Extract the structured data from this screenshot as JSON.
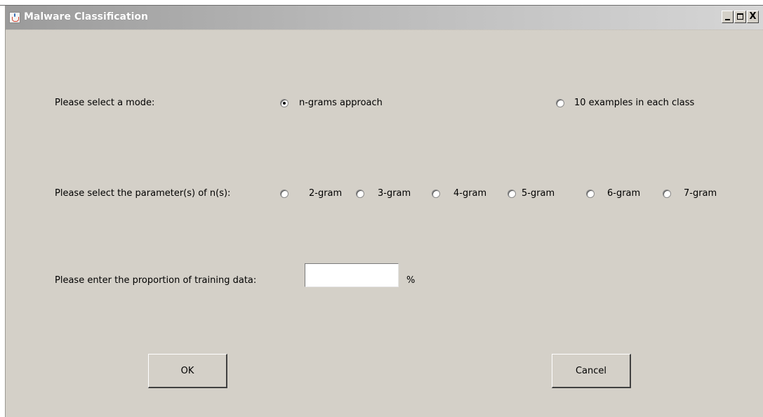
{
  "window": {
    "title": "Malware Classification",
    "icon": "java-cup-icon",
    "controls": {
      "minimize": "minimize-icon",
      "maximize": "maximize-icon",
      "close": "X"
    }
  },
  "mode": {
    "label": "Please select a mode:",
    "options": [
      {
        "label": "n-grams approach",
        "checked": true
      },
      {
        "label": "10 examples in each class",
        "checked": false
      }
    ]
  },
  "params": {
    "label": "Please select the parameter(s) of n(s):",
    "options": [
      {
        "label": "2-gram",
        "checked": false
      },
      {
        "label": "3-gram",
        "checked": false
      },
      {
        "label": "4-gram",
        "checked": false
      },
      {
        "label": "5-gram",
        "checked": false
      },
      {
        "label": "6-gram",
        "checked": false
      },
      {
        "label": "7-gram",
        "checked": false
      }
    ]
  },
  "training": {
    "label": "Please enter the proportion of training data:",
    "value": "",
    "unit": "%"
  },
  "buttons": {
    "ok": "OK",
    "cancel": "Cancel"
  },
  "colors": {
    "panel": "#d4d0c8",
    "title_gradient_start": "#9b9b9b",
    "title_gradient_end": "#d6d6d6"
  }
}
